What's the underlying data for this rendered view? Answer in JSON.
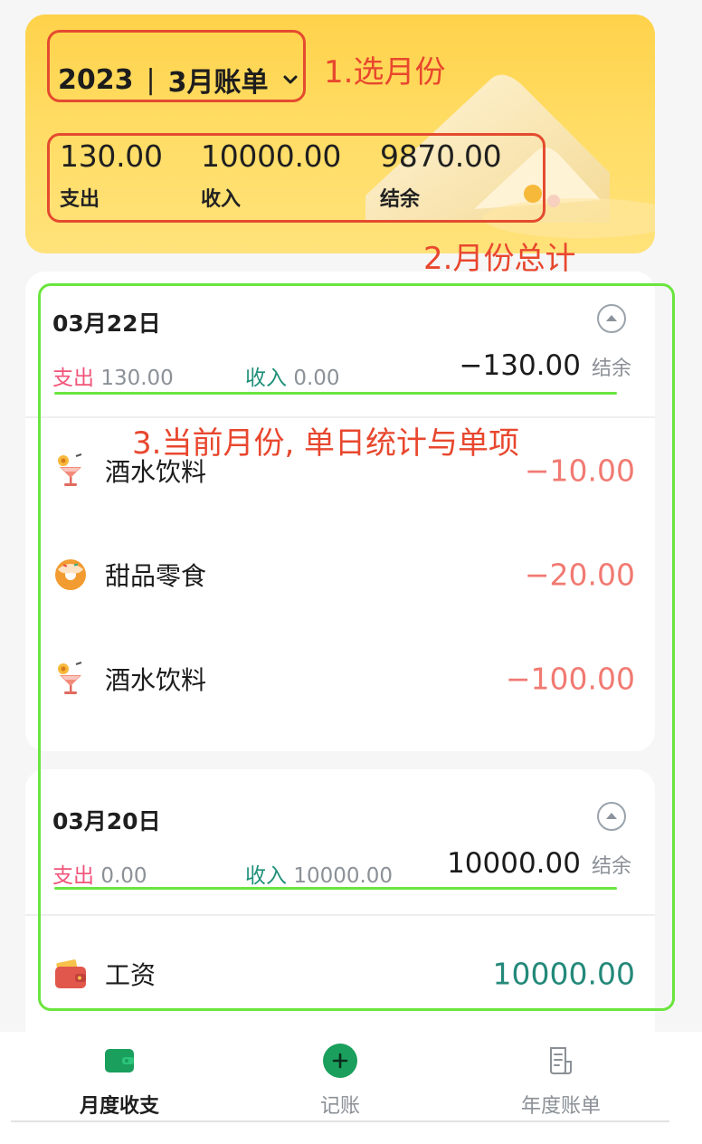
{
  "header": {
    "year": "2023",
    "separator": "|",
    "month_label": "3月账单",
    "summary": {
      "expense_value": "130.00",
      "expense_label": "支出",
      "income_value": "10000.00",
      "income_label": "收入",
      "balance_value": "9870.00",
      "balance_label": "结余"
    }
  },
  "annotations": {
    "a1": "1.选月份",
    "a2": "2.月份总计",
    "a3": "3.当前月份, 单日统计与单项"
  },
  "days": [
    {
      "date": "03月22日",
      "expense_label": "支出",
      "expense_value": "130.00",
      "income_label": "收入",
      "income_value": "0.00",
      "balance_value": "−130.00",
      "balance_label": "结余",
      "items": [
        {
          "name": "酒水饮料",
          "amount": "−10.00",
          "icon": "cocktail-icon"
        },
        {
          "name": "甜品零食",
          "amount": "−20.00",
          "icon": "donut-icon"
        },
        {
          "name": "酒水饮料",
          "amount": "−100.00",
          "icon": "cocktail-icon"
        }
      ]
    },
    {
      "date": "03月20日",
      "expense_label": "支出",
      "expense_value": "0.00",
      "income_label": "收入",
      "income_value": "10000.00",
      "balance_value": "10000.00",
      "balance_label": "结余",
      "items": [
        {
          "name": "工资",
          "amount": "10000.00",
          "icon": "wallet-icon"
        }
      ]
    }
  ],
  "nav": {
    "monthly": "月度收支",
    "record": "记账",
    "yearly": "年度账单"
  },
  "colors": {
    "brand_green": "#1a9f5c",
    "expense_red": "#f1557a",
    "income_teal": "#20907a",
    "annotation_red": "#e44b2f",
    "annotation_green": "#6ae53f"
  }
}
